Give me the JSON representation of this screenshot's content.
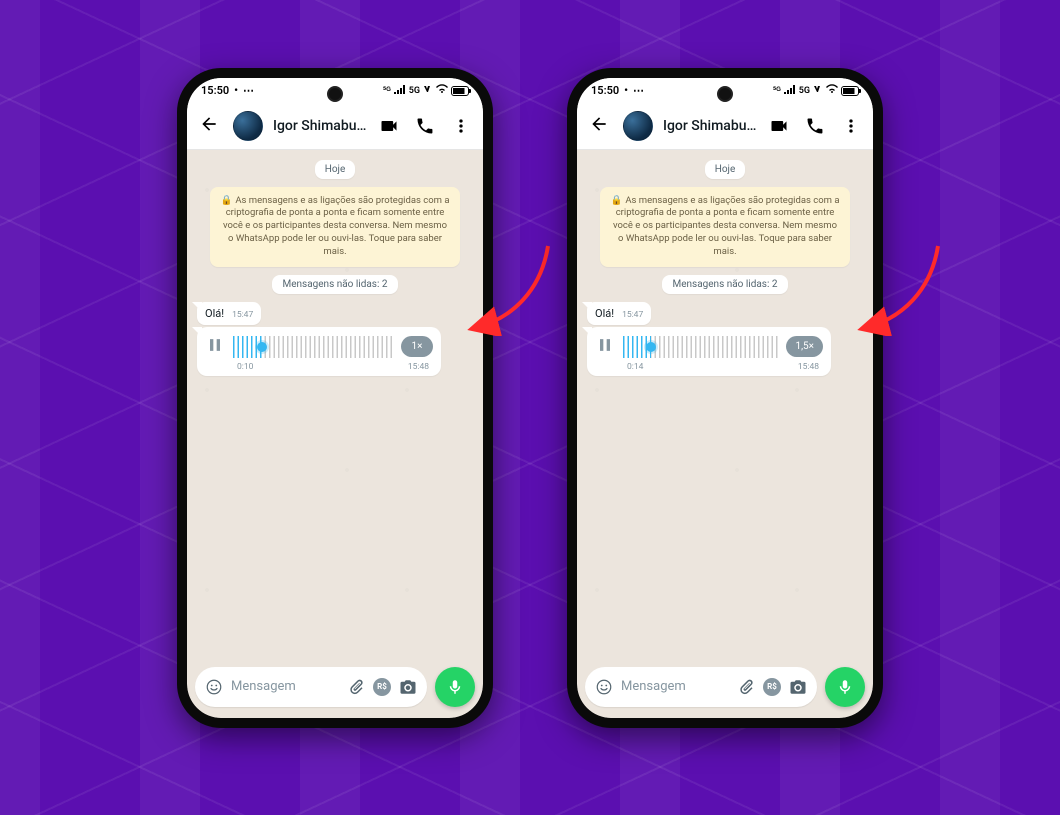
{
  "status": {
    "time": "15:50",
    "network": "5G",
    "battery": "83"
  },
  "header": {
    "contact_name": "Igor Shimabukuro"
  },
  "chat": {
    "date_pill": "Hoje",
    "encryption_notice": "As mensagens e as ligações são protegidas com a criptografia de ponta a ponta e ficam somente entre você e os participantes desta conversa. Nem mesmo o WhatsApp pode ler ou ouvi-las. Toque para saber mais.",
    "unread_pill": "Mensagens não lidas: 2",
    "text_msg": {
      "text": "Olá!",
      "time": "15:47"
    },
    "audio_common": {
      "timestamp": "15:48"
    }
  },
  "composer": {
    "placeholder": "Mensagem"
  },
  "phones": [
    {
      "audio": {
        "elapsed": "0:10",
        "speed_label": "1×",
        "progress_pct": 18
      }
    },
    {
      "audio": {
        "elapsed": "0:14",
        "speed_label": "1,5×",
        "progress_pct": 18
      }
    }
  ],
  "colors": {
    "purple": "#5B0FB0",
    "arrow": "#ff2a2a",
    "whatsapp_green": "#25D366",
    "speed_pill": "#8696a0"
  }
}
